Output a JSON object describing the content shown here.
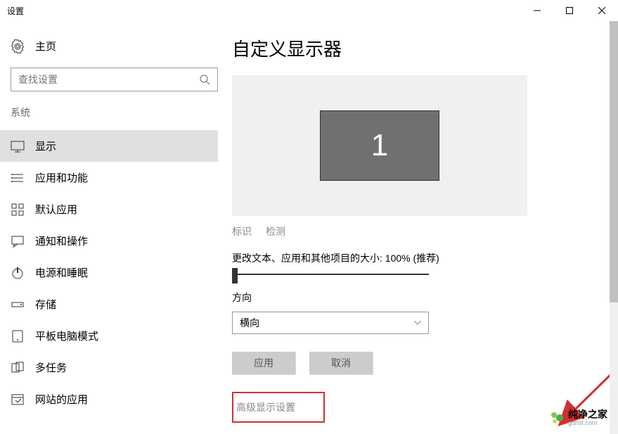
{
  "window": {
    "title": "设置"
  },
  "sidebar": {
    "home": "主页",
    "search_placeholder": "查找设置",
    "section": "系统",
    "items": [
      {
        "label": "显示"
      },
      {
        "label": "应用和功能"
      },
      {
        "label": "默认应用"
      },
      {
        "label": "通知和操作"
      },
      {
        "label": "电源和睡眠"
      },
      {
        "label": "存储"
      },
      {
        "label": "平板电脑模式"
      },
      {
        "label": "多任务"
      },
      {
        "label": "网站的应用"
      }
    ]
  },
  "main": {
    "title": "自定义显示器",
    "monitor_id": "1",
    "links": {
      "identify": "标识",
      "detect": "检测"
    },
    "scale_label": "更改文本、应用和其他项目的大小: 100% (推荐)",
    "orientation_label": "方向",
    "orientation_value": "横向",
    "apply_btn": "应用",
    "cancel_btn": "取消",
    "advanced_link": "高级显示设置"
  },
  "watermark": {
    "main": "纯净之家",
    "sub": "gdhst.com"
  }
}
